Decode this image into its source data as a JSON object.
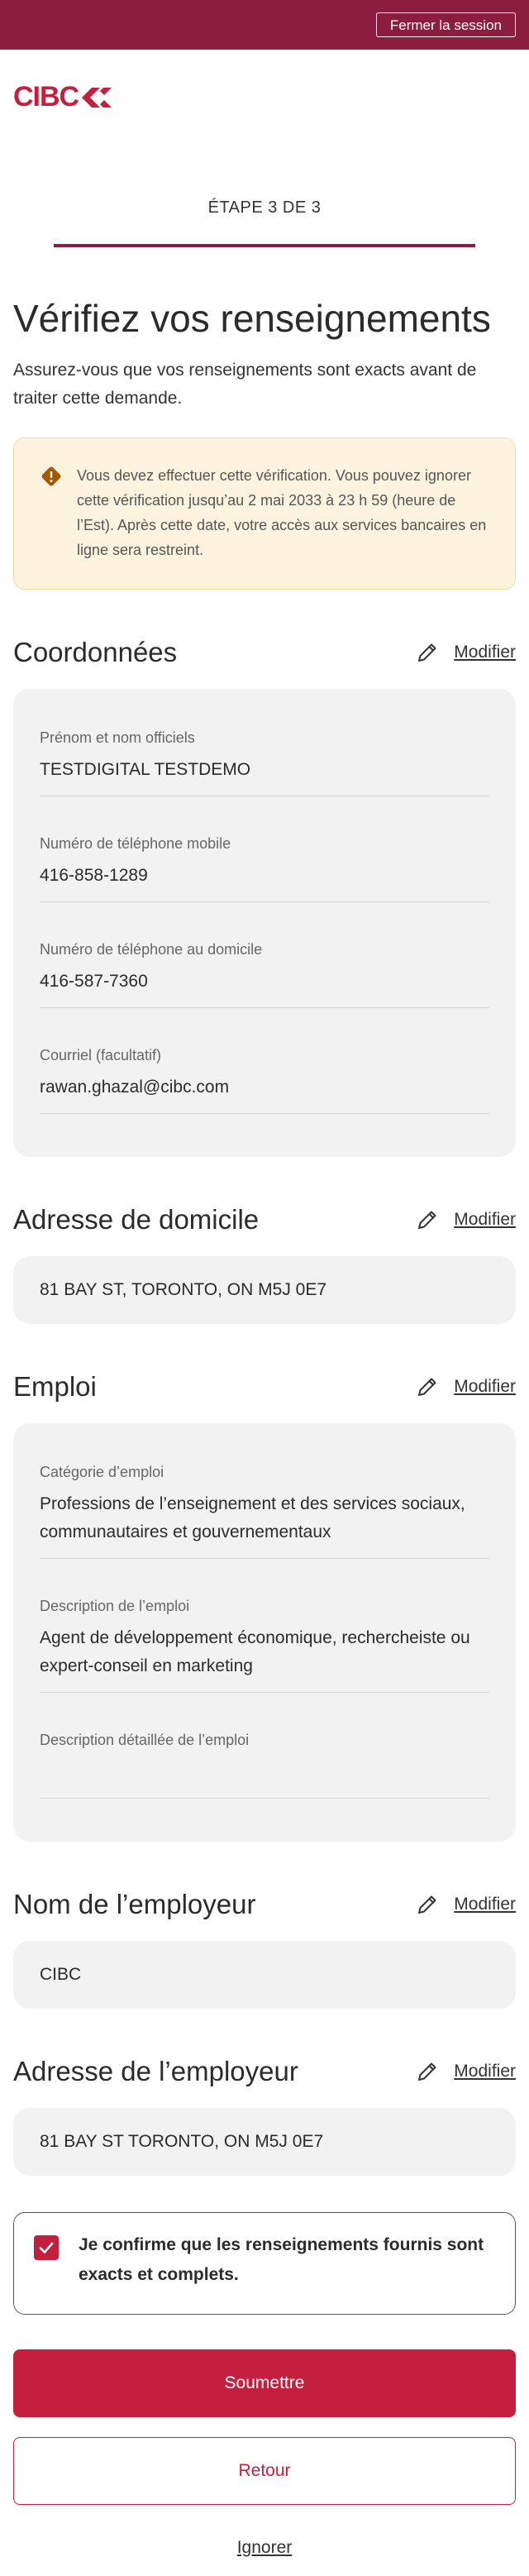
{
  "header": {
    "logout_label": "Fermer la session",
    "brand": "CIBC",
    "brand_color": "#c41f3e",
    "bar_color": "#8b1d41"
  },
  "progress": {
    "label": "ÉTAPE 3 DE 3"
  },
  "page": {
    "title": "Vérifiez vos renseignements",
    "intro": "Assurez-vous que vos renseignements sont exacts avant de traiter cette demande.",
    "alert_text": "Vous devez effectuer cette vérification. Vous pouvez ignorer cette vérification jusqu’au 2 mai 2033 à 23 h 59 (heure de l’Est). Après cette date, votre accès aux services bancaires en ligne sera restreint.",
    "alert_icon": "warning-icon",
    "modify_label": "Modifier",
    "modify_icon": "pencil-icon"
  },
  "contact": {
    "title": "Coordonnées",
    "fields": [
      {
        "label": "Prénom et nom officiels",
        "value": "TESTDIGITAL TESTDEMO"
      },
      {
        "label": "Numéro de téléphone mobile",
        "value": "416-858-1289"
      },
      {
        "label": "Numéro de téléphone au domicile",
        "value": "416-587-7360"
      },
      {
        "label": "Courriel (facultatif)",
        "value": "rawan.ghazal@cibc.com"
      }
    ]
  },
  "home_address": {
    "title": "Adresse de domicile",
    "value": "81 BAY ST, TORONTO, ON M5J 0E7"
  },
  "employment": {
    "title": "Emploi",
    "fields": [
      {
        "label": "Catégorie d’emploi",
        "value": "Professions de l’enseignement et des services sociaux, communautaires et gouvernementaux"
      },
      {
        "label": "Description de l’emploi",
        "value": "Agent de développement économique, rechercheiste ou expert-conseil en marketing"
      },
      {
        "label": "Description détaillée de l’emploi",
        "value": ""
      }
    ]
  },
  "employer_name": {
    "title": "Nom de l’employeur",
    "value": "CIBC"
  },
  "employer_address": {
    "title": "Adresse de l’employeur",
    "value": "81 BAY ST TORONTO, ON M5J 0E7"
  },
  "confirm": {
    "label": "Je confirme que les renseignements fournis sont exacts et complets.",
    "checked": true
  },
  "actions": {
    "submit_label": "Soumettre",
    "back_label": "Retour",
    "ignore_label": "Ignorer"
  }
}
